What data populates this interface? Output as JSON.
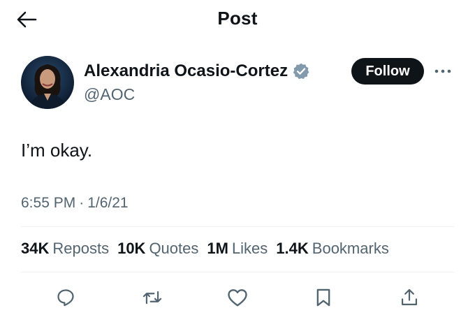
{
  "header": {
    "title": "Post",
    "back_icon": "arrow-left-icon"
  },
  "author": {
    "name": "Alexandria Ocasio-Cortez",
    "handle": "@AOC",
    "verified": true,
    "verified_color": "#829aab",
    "avatar_icon": "avatar"
  },
  "follow_button": {
    "label": "Follow"
  },
  "more_icon": "more-dots-icon",
  "tweet": {
    "text": "I’m okay.",
    "time": "6:55 PM",
    "separator": "·",
    "date": "1/6/21"
  },
  "stats": [
    {
      "count": "34K",
      "label": "Reposts"
    },
    {
      "count": "10K",
      "label": "Quotes"
    },
    {
      "count": "1M",
      "label": "Likes"
    },
    {
      "count": "1.4K",
      "label": "Bookmarks"
    }
  ],
  "actions": [
    {
      "icon": "reply-icon"
    },
    {
      "icon": "repost-icon"
    },
    {
      "icon": "like-icon"
    },
    {
      "icon": "bookmark-icon"
    },
    {
      "icon": "share-icon"
    }
  ],
  "colors": {
    "text_primary": "#0f1419",
    "text_secondary": "#536471",
    "divider": "#eff3f4",
    "follow_bg": "#0f1419"
  }
}
